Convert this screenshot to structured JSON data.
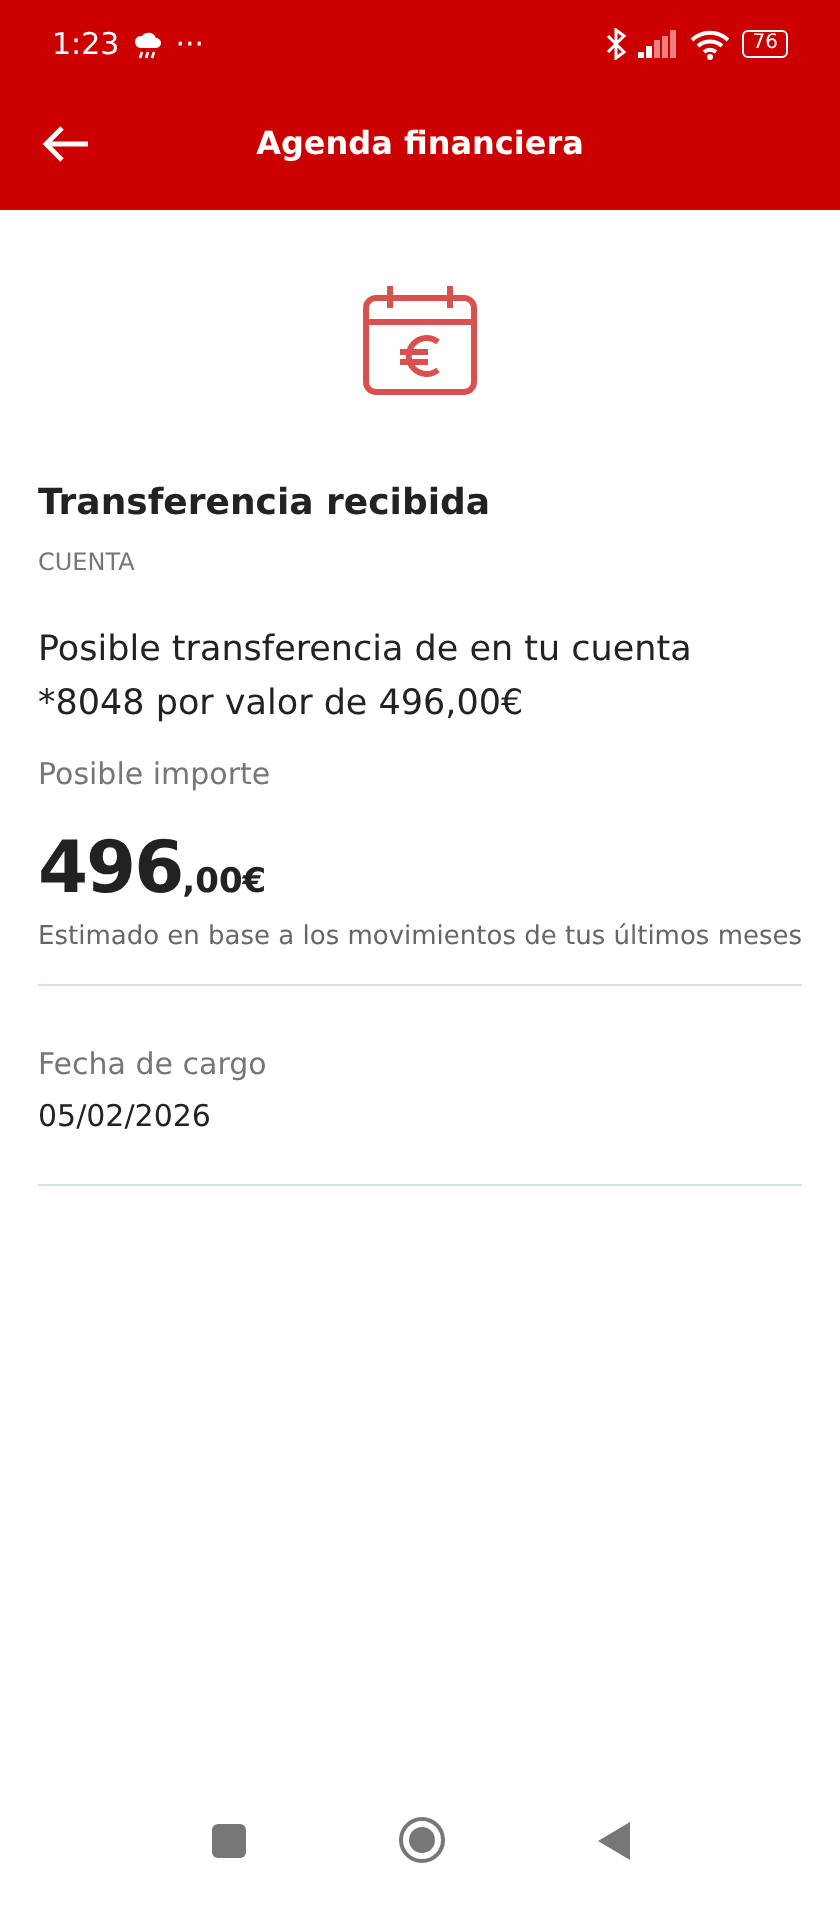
{
  "status_bar": {
    "time": "1:23",
    "more": "···",
    "battery": "76"
  },
  "header": {
    "title": "Agenda financiera"
  },
  "event": {
    "title": "Transferencia recibida",
    "category": "CUENTA",
    "description": "Posible transferencia de  en tu cuenta *8048 por valor de 496,00€",
    "amount_label": "Posible importe",
    "amount_integer": "496",
    "amount_decimals": ",00€",
    "amount_note": "Estimado en base a los movimientos de tus últimos meses"
  },
  "details": [
    {
      "label": "Fecha de cargo",
      "value": "05/02/2026"
    }
  ]
}
